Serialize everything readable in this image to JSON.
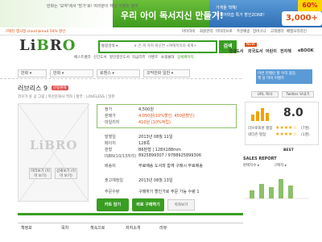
{
  "banner": {
    "small_line1": "만화는 '보약'에서 '방가'로! 여러분이 해당 이벤트 참여 ",
    "small_line2": "",
    "main_title": "우리 아이 독서지신 만들기!",
    "sub": "",
    "right_title": "",
    "right_sub1": "가게들 책혜/",
    "right_sub2": "외국어학습 특가 할인ZONE!",
    "pct": "60%",
    "won": "3,000+"
  },
  "topnav": {
    "left": "구매된 행사정 cloud bread 50% 할인",
    "items": [
      "아이하이",
      "회원관리",
      "마이리브로",
      "주문배송",
      "장바구니",
      "고객센터",
      "배열모리라인"
    ]
  },
  "logo": {
    "text_a": "Li",
    "text_b": "B",
    "text_c": "R",
    "text_d": "O"
  },
  "search": {
    "category": "통합검색 ▾",
    "placeholder": "ㅎ.은.피 자차 최신연 <여해저리의 세계>",
    "button": "검색"
  },
  "nav_tabs": [
    "NEW",
    "국내도서",
    "외국도서",
    "어린이",
    "전자책",
    "eBOOK"
  ],
  "subnav": [
    "베스트셀러",
    "신간도서",
    "할인중인도서",
    "지금리뷰",
    "이벤트",
    "쇼핑몰대",
    "상세페이지"
  ],
  "ad": {
    "line1": "이번 한챌런 할 우리 없음",
    "line2": "책 당 마이 이벤트"
  },
  "breadcrumbs": [
    "만화",
    "만화",
    "로맨스",
    "코믹만화 일반"
  ],
  "book": {
    "title": "러브리스 9",
    "badge": "한정판매",
    "author": "코우가 윤 공 그림  |  학산문화사 역자  |  할부 : LOVELESS  |  일본"
  },
  "buttons": {
    "preview": "미리보기\n(이미 보기)",
    "extra": "상세보기\n(이미 보기)",
    "cart": "카트 담기",
    "buy": "바로 구매하기",
    "wish": "목차보기"
  },
  "price": {
    "list_label": "정가",
    "list_value": "4,500원",
    "sale_label": "판매가",
    "sale_value": "4,050원(10%할인, 450원할인)",
    "point_label": "마일리지",
    "point_value": "410원 (10%적립)"
  },
  "details": [
    {
      "label": "발행일",
      "value": "2013년 08월 11일"
    },
    {
      "label": "페이지",
      "value": "128쪽"
    },
    {
      "label": "판형",
      "value": "B6판형 | 128X188mm"
    },
    {
      "label": "ISBN(10/13자리)",
      "value": "8925899307 / 9788925899306"
    },
    {
      "label": "배송비",
      "value": "무료배송 도서와 함께 구매시 무료배송"
    },
    {
      "label": "출고예정일",
      "value": "2013년 08월 13일"
    },
    {
      "label": "주문수량",
      "value": "구매하기 할인가로 주문 가능 수량 1"
    }
  ],
  "subtitle_strip": {
    "label": "",
    "select": ""
  },
  "rightcol": {
    "ctrl_a": "URL 복사",
    "ctrl_b": "Twitter 보내기",
    "score": "8.0",
    "rating_label": "리브로회원 평점",
    "rating_count": "(7명)",
    "netizen_label": "네티즌 평점",
    "netizen_count": "(1명)",
    "best_label": "BEST",
    "sales_report": "SALES REPORT",
    "sales_links": [
      "판매지수 ▸",
      "구매자 ▸"
    ]
  },
  "bottom_nav": [
    "책정보",
    "목차",
    "책속으로",
    "저자소개",
    "리뷰"
  ],
  "colors": {
    "brand": "#3a9d23",
    "sale": "#e05010",
    "star": "#f5a200"
  }
}
